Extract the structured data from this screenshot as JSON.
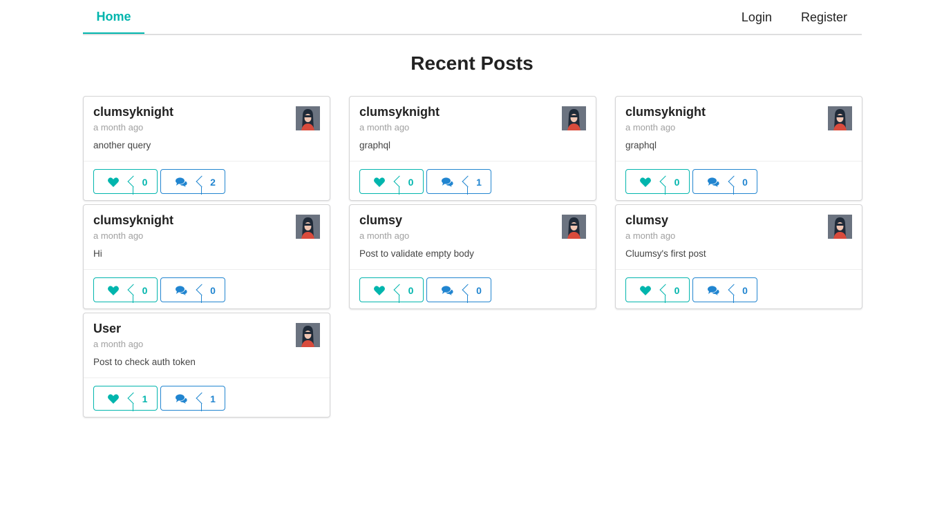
{
  "nav": {
    "home": "Home",
    "login": "Login",
    "register": "Register"
  },
  "page": {
    "title": "Recent Posts"
  },
  "colors": {
    "accent_teal": "#00b5ad",
    "accent_blue": "#2185d0"
  },
  "posts": [
    {
      "username": "clumsyknight",
      "time": "a month ago",
      "body": "another query",
      "likes": "0",
      "comments": "2"
    },
    {
      "username": "clumsyknight",
      "time": "a month ago",
      "body": "graphql",
      "likes": "0",
      "comments": "1"
    },
    {
      "username": "clumsyknight",
      "time": "a month ago",
      "body": "graphql",
      "likes": "0",
      "comments": "0"
    },
    {
      "username": "clumsyknight",
      "time": "a month ago",
      "body": "Hi",
      "likes": "0",
      "comments": "0"
    },
    {
      "username": "clumsy",
      "time": "a month ago",
      "body": "Post to validate empty body",
      "likes": "0",
      "comments": "0"
    },
    {
      "username": "clumsy",
      "time": "a month ago",
      "body": "Cluumsy's first post",
      "likes": "0",
      "comments": "0"
    },
    {
      "username": "User",
      "time": "a month ago",
      "body": "Post to check auth token",
      "likes": "1",
      "comments": "1"
    }
  ],
  "icons": {
    "like": "heart-icon",
    "comment": "comments-icon",
    "avatar": "avatar-image"
  }
}
